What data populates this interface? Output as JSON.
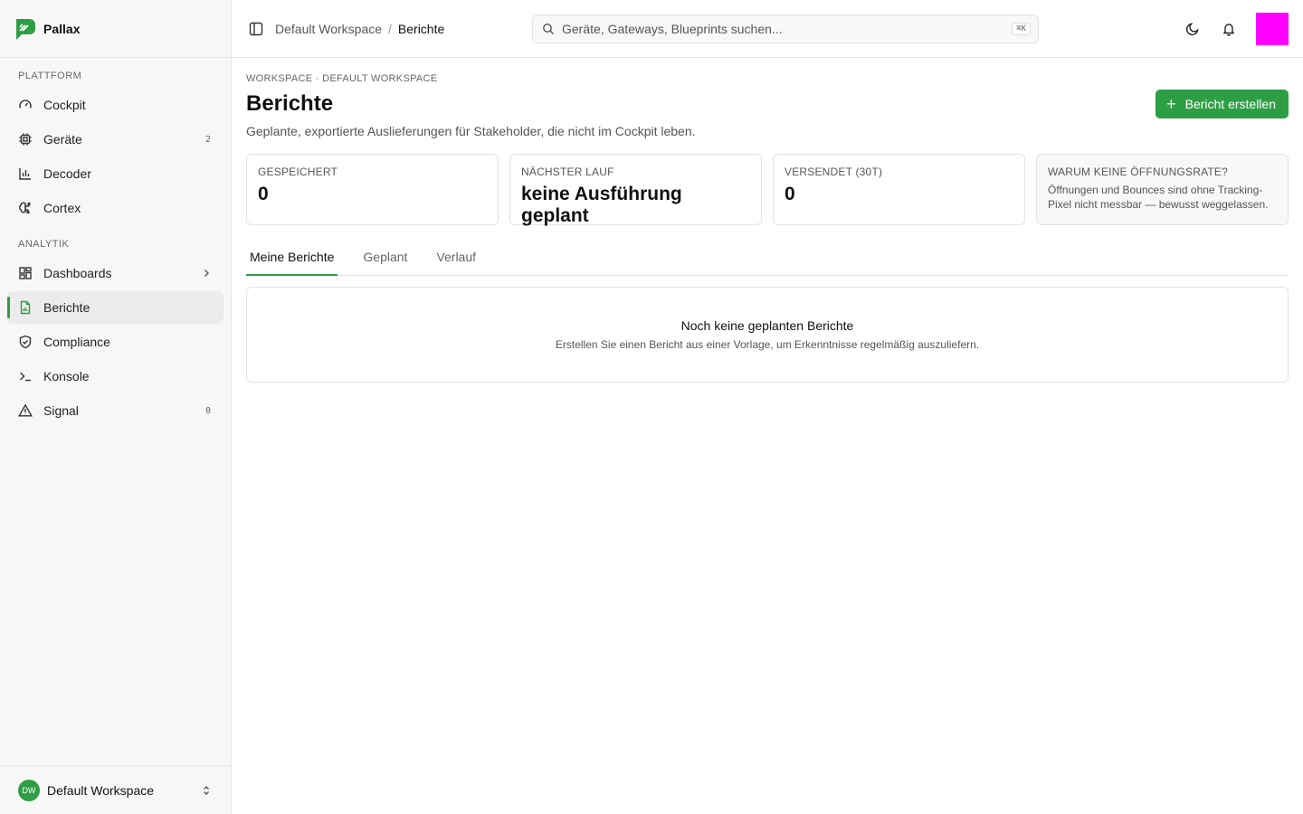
{
  "app": {
    "name": "Pallax"
  },
  "colors": {
    "accent": "#2e9e44",
    "user_avatar": "#ff00ff"
  },
  "sidebar": {
    "sections": [
      {
        "title": "PLATTFORM",
        "items": [
          {
            "label": "Cockpit",
            "icon": "gauge-icon"
          },
          {
            "label": "Geräte",
            "icon": "chip-icon",
            "badge": "2"
          },
          {
            "label": "Decoder",
            "icon": "bar-chart-icon"
          },
          {
            "label": "Cortex",
            "icon": "brain-icon"
          }
        ]
      },
      {
        "title": "ANALYTIK",
        "items": [
          {
            "label": "Dashboards",
            "icon": "grid-icon"
          },
          {
            "label": "Berichte",
            "icon": "report-icon",
            "active": true
          },
          {
            "label": "Compliance",
            "icon": "shield-check-icon"
          },
          {
            "label": "Konsole",
            "icon": "terminal-icon"
          },
          {
            "label": "Signal",
            "icon": "warning-icon",
            "badge": "0"
          }
        ]
      }
    ],
    "workspace": {
      "initials": "DW",
      "name": "Default Workspace"
    }
  },
  "topbar": {
    "breadcrumb": [
      "Default Workspace",
      "Berichte"
    ],
    "search": {
      "placeholder": "Geräte, Gateways, Blueprints suchen...",
      "shortcut": "⌘K"
    }
  },
  "main": {
    "eyebrow": "WORKSPACE · DEFAULT WORKSPACE",
    "title": "Berichte",
    "create_label": "Bericht erstellen",
    "subtitle": "Geplante, exportierte Auslieferungen für Stakeholder, die nicht im Cockpit leben.",
    "stats": [
      {
        "label": "GESPEICHERT",
        "value": "0"
      },
      {
        "label": "NÄCHSTER LAUF",
        "value": "keine Ausführung geplant"
      },
      {
        "label": "VERSENDET (30T)",
        "value": "0"
      }
    ],
    "note": {
      "label": "WARUM KEINE ÖFFNUNGSRATE?",
      "text": "Öffnungen und Bounces sind ohne Tracking-Pixel nicht messbar — bewusst weggelassen."
    },
    "tabs": [
      {
        "label": "Meine Berichte",
        "active": true
      },
      {
        "label": "Geplant"
      },
      {
        "label": "Verlauf"
      }
    ],
    "empty": {
      "title": "Noch keine geplanten Berichte",
      "text": "Erstellen Sie einen Bericht aus einer Vorlage, um Erkenntnisse regelmäßig auszuliefern."
    }
  }
}
